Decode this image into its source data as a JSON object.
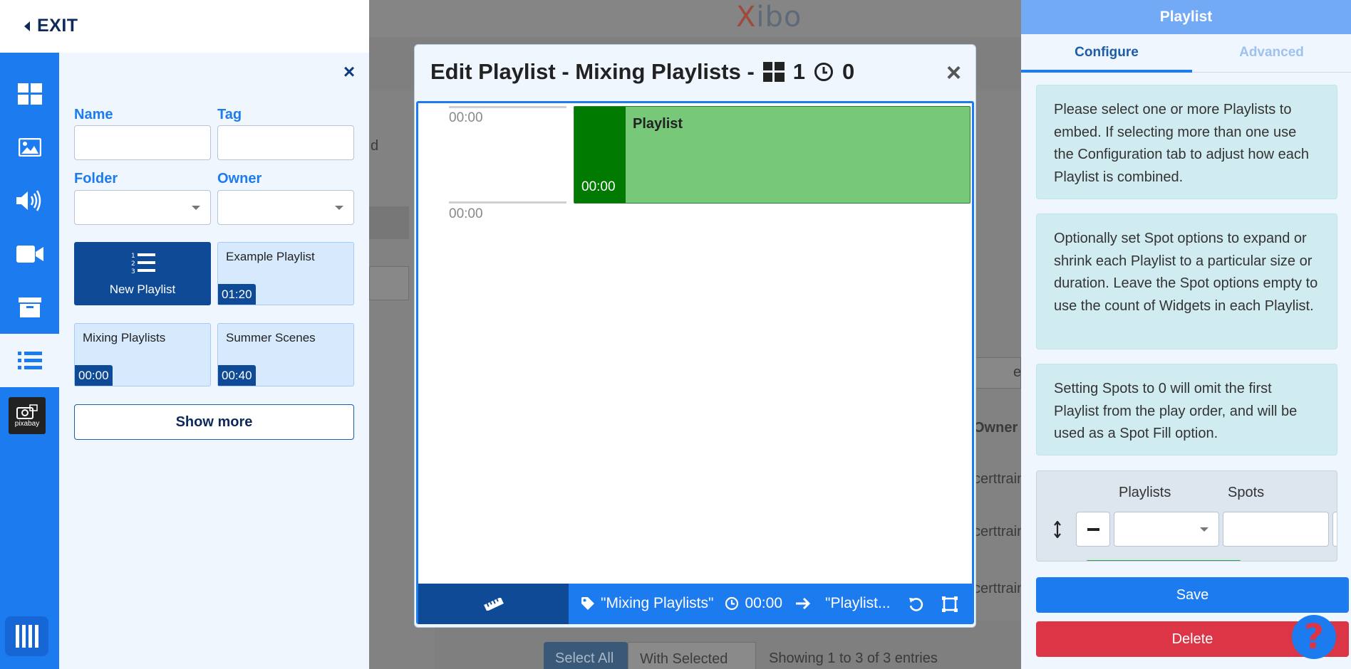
{
  "header": {
    "exit_label": "EXIT"
  },
  "toolbar": {
    "items": [
      "layouts-icon",
      "image-icon",
      "audio-icon",
      "video-icon",
      "archive-icon",
      "playlist-icon",
      "pixabay-icon",
      "library-icon"
    ],
    "pixabay_label": "pixabay"
  },
  "library_panel": {
    "name_label": "Name",
    "tag_label": "Tag",
    "folder_label": "Folder",
    "owner_label": "Owner",
    "name_value": "",
    "tag_value": "",
    "folder_value": "",
    "owner_value": "",
    "new_playlist_label": "New Playlist",
    "cards": [
      {
        "title": "Example Playlist",
        "duration": "01:20"
      },
      {
        "title": "Mixing Playlists",
        "duration": "00:00"
      },
      {
        "title": "Summer Scenes",
        "duration": "00:40"
      }
    ],
    "show_more_label": "Show more"
  },
  "background": {
    "brand_x": "X",
    "brand_rest": "ibo",
    "owner_header": "Owner",
    "row_fragments": [
      "certtrain",
      "certtrain",
      "certtrain"
    ],
    "partial_d": "d",
    "partial_e": "e",
    "select_all_label": "Select All",
    "with_selected_label": "With Selected",
    "entries_text": "Showing 1 to 3 of 3 entries"
  },
  "modal": {
    "title": "Edit Playlist - Mixing Playlists -",
    "widget_count": "1",
    "duration_count": "0",
    "timeline": {
      "time_top": "00:00",
      "time_bottom": "00:00",
      "block_name": "Playlist",
      "block_duration": "00:00"
    },
    "footer": {
      "playlist_name": "\"Mixing Playlists\"",
      "duration": "00:00",
      "target": "\"Playlist..."
    }
  },
  "properties": {
    "header": "Playlist",
    "tab_configure": "Configure",
    "tab_advanced": "Advanced",
    "info_1": "Please select one or more Playlists to embed. If selecting more than one use the Configuration tab to adjust how each Playlist is combined.",
    "info_2": "Optionally set Spot options to expand or shrink each Playlist to a particular size or duration. Leave the Spot options empty to use the count of Widgets in each Playlist.",
    "info_3": "Setting Spots to 0 will omit the first Playlist from the play order, and will be used as a Spot Fill option.",
    "col_playlists": "Playlists",
    "col_spots": "Spots",
    "playlist_select_value": "",
    "spots_value": "",
    "save_label": "Save",
    "delete_label": "Delete",
    "help_label": "?"
  },
  "colors": {
    "primary": "#1d7bf0",
    "dark_primary": "#0e4a95",
    "danger": "#dc3545",
    "success": "#28a745",
    "timeline_block": "#77c979",
    "timeline_block_dark": "#007a00",
    "info_bg": "#d1ecf1"
  }
}
